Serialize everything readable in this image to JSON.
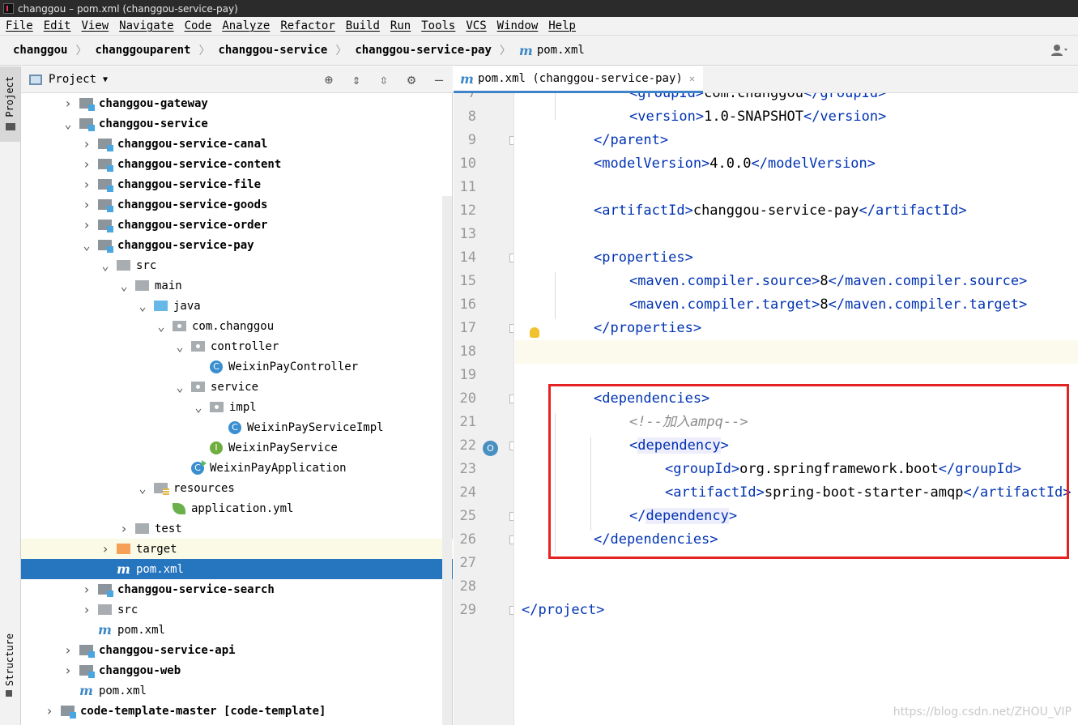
{
  "window": {
    "title": "changgou – pom.xml (changgou-service-pay)"
  },
  "menu": [
    "File",
    "Edit",
    "View",
    "Navigate",
    "Code",
    "Analyze",
    "Refactor",
    "Build",
    "Run",
    "Tools",
    "VCS",
    "Window",
    "Help"
  ],
  "breadcrumb": [
    "changgou",
    "changgouparent",
    "changgou-service",
    "changgou-service-pay",
    "pom.xml"
  ],
  "sidebar": {
    "project_tab": "Project",
    "structure_tab": "Structure"
  },
  "project_panel": {
    "title": "Project",
    "tree": [
      {
        "label": "changgou-gateway",
        "depth": 2,
        "expand": "collapsed",
        "icon": "module",
        "bold": true
      },
      {
        "label": "changgou-service",
        "depth": 2,
        "expand": "expanded",
        "icon": "module",
        "bold": true
      },
      {
        "label": "changgou-service-canal",
        "depth": 3,
        "expand": "collapsed",
        "icon": "module",
        "bold": true
      },
      {
        "label": "changgou-service-content",
        "depth": 3,
        "expand": "collapsed",
        "icon": "module",
        "bold": true
      },
      {
        "label": "changgou-service-file",
        "depth": 3,
        "expand": "collapsed",
        "icon": "module",
        "bold": true
      },
      {
        "label": "changgou-service-goods",
        "depth": 3,
        "expand": "collapsed",
        "icon": "module",
        "bold": true
      },
      {
        "label": "changgou-service-order",
        "depth": 3,
        "expand": "collapsed",
        "icon": "module",
        "bold": true
      },
      {
        "label": "changgou-service-pay",
        "depth": 3,
        "expand": "expanded",
        "icon": "module",
        "bold": true
      },
      {
        "label": "src",
        "depth": 4,
        "expand": "expanded",
        "icon": "folder",
        "bold": false
      },
      {
        "label": "main",
        "depth": 5,
        "expand": "expanded",
        "icon": "folder",
        "bold": false
      },
      {
        "label": "java",
        "depth": 6,
        "expand": "expanded",
        "icon": "folder-blue",
        "bold": false
      },
      {
        "label": "com.changgou",
        "depth": 7,
        "expand": "expanded",
        "icon": "pkg",
        "bold": false
      },
      {
        "label": "controller",
        "depth": 8,
        "expand": "expanded",
        "icon": "pkg",
        "bold": false
      },
      {
        "label": "WeixinPayController",
        "depth": 9,
        "expand": "none",
        "icon": "class",
        "bold": false
      },
      {
        "label": "service",
        "depth": 8,
        "expand": "expanded",
        "icon": "pkg",
        "bold": false
      },
      {
        "label": "impl",
        "depth": 9,
        "expand": "expanded",
        "icon": "pkg",
        "bold": false
      },
      {
        "label": "WeixinPayServiceImpl",
        "depth": 10,
        "expand": "none",
        "icon": "class",
        "bold": false
      },
      {
        "label": "WeixinPayService",
        "depth": 9,
        "expand": "none",
        "icon": "iface",
        "bold": false
      },
      {
        "label": "WeixinPayApplication",
        "depth": 8,
        "expand": "none",
        "icon": "app",
        "bold": false
      },
      {
        "label": "resources",
        "depth": 6,
        "expand": "expanded",
        "icon": "folder-res",
        "bold": false
      },
      {
        "label": "application.yml",
        "depth": 7,
        "expand": "none",
        "icon": "leaf",
        "bold": false
      },
      {
        "label": "test",
        "depth": 5,
        "expand": "collapsed",
        "icon": "folder",
        "bold": false
      },
      {
        "label": "target",
        "depth": 4,
        "expand": "collapsed",
        "icon": "folder-orange",
        "bold": false,
        "state": "hover"
      },
      {
        "label": "pom.xml",
        "depth": 4,
        "expand": "none",
        "icon": "maven",
        "bold": false,
        "state": "selected"
      },
      {
        "label": "changgou-service-search",
        "depth": 3,
        "expand": "collapsed",
        "icon": "module",
        "bold": true
      },
      {
        "label": "src",
        "depth": 3,
        "expand": "collapsed",
        "icon": "folder",
        "bold": false
      },
      {
        "label": "pom.xml",
        "depth": 3,
        "expand": "none",
        "icon": "maven",
        "bold": false
      },
      {
        "label": "changgou-service-api",
        "depth": 2,
        "expand": "collapsed",
        "icon": "module",
        "bold": true
      },
      {
        "label": "changgou-web",
        "depth": 2,
        "expand": "collapsed",
        "icon": "module",
        "bold": true
      },
      {
        "label": "pom.xml",
        "depth": 2,
        "expand": "none",
        "icon": "maven",
        "bold": false
      },
      {
        "label": "code-template-master [code-template]",
        "depth": 1,
        "expand": "collapsed",
        "icon": "module",
        "bold": true
      }
    ]
  },
  "editor": {
    "tab_label": "pom.xml (changgou-service-pay)",
    "lines": [
      {
        "num": "7",
        "indent": 2,
        "parts": [
          [
            "tag",
            "<groupId>"
          ],
          [
            "text",
            "com.changgou"
          ],
          [
            "tag",
            "</groupId>"
          ]
        ]
      },
      {
        "num": "8",
        "indent": 2,
        "parts": [
          [
            "tag",
            "<version>"
          ],
          [
            "text",
            "1.0-SNAPSHOT"
          ],
          [
            "tag",
            "</version>"
          ]
        ]
      },
      {
        "num": "9",
        "indent": 1,
        "parts": [
          [
            "tag",
            "</parent>"
          ]
        ]
      },
      {
        "num": "10",
        "indent": 1,
        "parts": [
          [
            "tag",
            "<modelVersion>"
          ],
          [
            "text",
            "4.0.0"
          ],
          [
            "tag",
            "</modelVersion>"
          ]
        ]
      },
      {
        "num": "11",
        "indent": 0,
        "parts": []
      },
      {
        "num": "12",
        "indent": 1,
        "parts": [
          [
            "tag",
            "<artifactId>"
          ],
          [
            "text",
            "changgou-service-pay"
          ],
          [
            "tag",
            "</artifactId>"
          ]
        ]
      },
      {
        "num": "13",
        "indent": 0,
        "parts": []
      },
      {
        "num": "14",
        "indent": 1,
        "parts": [
          [
            "tag",
            "<properties>"
          ]
        ]
      },
      {
        "num": "15",
        "indent": 2,
        "parts": [
          [
            "tag",
            "<maven.compiler.source>"
          ],
          [
            "text",
            "8"
          ],
          [
            "tag",
            "</maven.compiler.source>"
          ]
        ]
      },
      {
        "num": "16",
        "indent": 2,
        "parts": [
          [
            "tag",
            "<maven.compiler.target>"
          ],
          [
            "text",
            "8"
          ],
          [
            "tag",
            "</maven.compiler.target>"
          ]
        ]
      },
      {
        "num": "17",
        "indent": 1,
        "parts": [
          [
            "tag",
            "</properties>"
          ]
        ]
      },
      {
        "num": "18",
        "indent": 0,
        "parts": [],
        "cursor": true
      },
      {
        "num": "19",
        "indent": 0,
        "parts": []
      },
      {
        "num": "20",
        "indent": 1,
        "parts": [
          [
            "tag",
            "<dependencies>"
          ]
        ]
      },
      {
        "num": "21",
        "indent": 2,
        "parts": [
          [
            "cmt",
            "<!--加入ampq-->"
          ]
        ]
      },
      {
        "num": "22",
        "indent": 2,
        "parts": [
          [
            "tag",
            "<"
          ],
          [
            "hl",
            "dependency"
          ],
          [
            "tag",
            ">"
          ]
        ]
      },
      {
        "num": "23",
        "indent": 3,
        "parts": [
          [
            "tag",
            "<groupId>"
          ],
          [
            "text",
            "org.springframework.boot"
          ],
          [
            "tag",
            "</groupId>"
          ]
        ]
      },
      {
        "num": "24",
        "indent": 3,
        "parts": [
          [
            "tag",
            "<artifactId>"
          ],
          [
            "text",
            "spring-boot-starter-amqp"
          ],
          [
            "tag",
            "</artifactId>"
          ]
        ]
      },
      {
        "num": "25",
        "indent": 2,
        "parts": [
          [
            "tag",
            "</"
          ],
          [
            "hl",
            "dependency"
          ],
          [
            "tag",
            ">"
          ]
        ]
      },
      {
        "num": "26",
        "indent": 1,
        "parts": [
          [
            "tag",
            "</dependencies>"
          ]
        ]
      },
      {
        "num": "27",
        "indent": 0,
        "parts": []
      },
      {
        "num": "28",
        "indent": 0,
        "parts": []
      },
      {
        "num": "29",
        "indent": 0,
        "parts": [
          [
            "tag",
            "</project>"
          ]
        ]
      }
    ]
  },
  "watermark": "https://blog.csdn.net/ZHOU_VIP",
  "colors": {
    "selection": "#2675bf",
    "tag": "#0033b3",
    "highlight_box": "#e52222"
  }
}
